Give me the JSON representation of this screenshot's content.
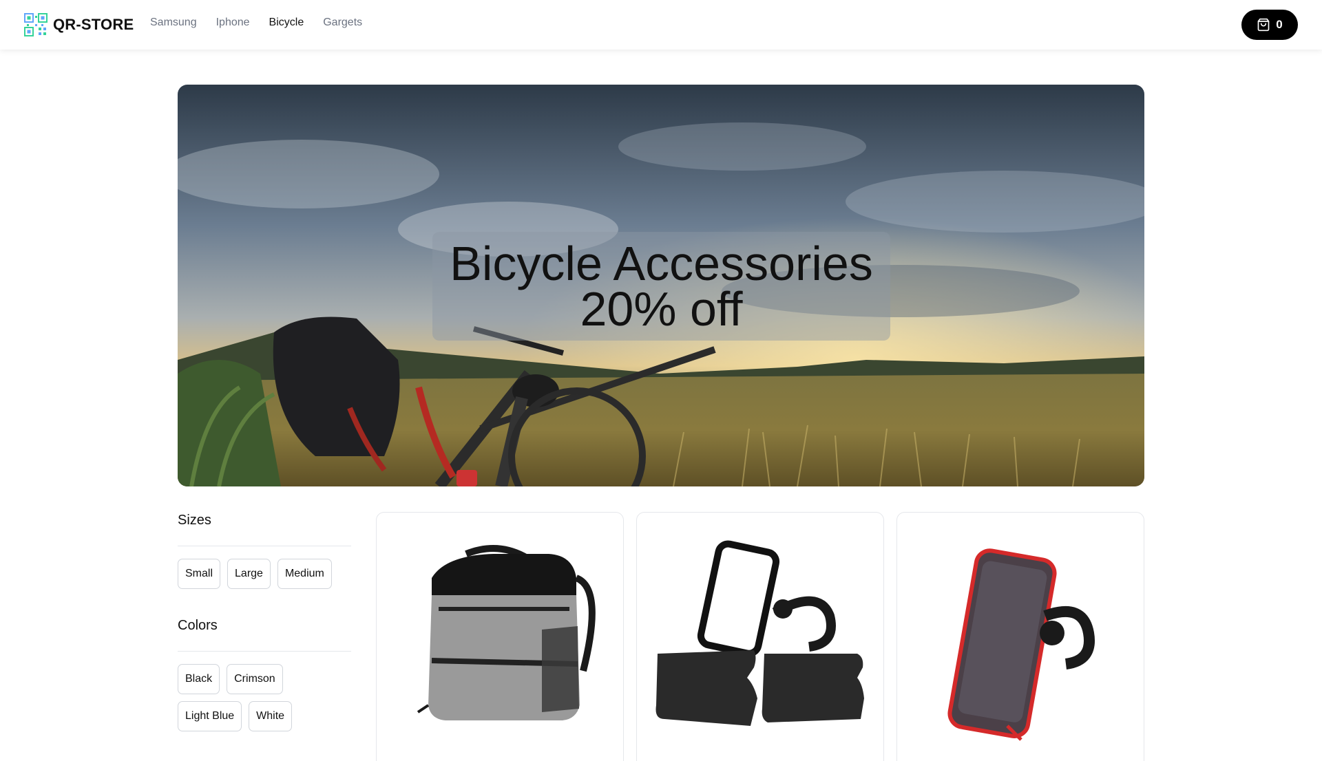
{
  "header": {
    "brand": "QR-STORE",
    "nav": [
      {
        "label": "Samsung",
        "active": false
      },
      {
        "label": "Iphone",
        "active": false
      },
      {
        "label": "Bicycle",
        "active": true
      },
      {
        "label": "Gargets",
        "active": false
      }
    ],
    "cart_count": "0"
  },
  "hero": {
    "title": "Bicycle Accessories",
    "subtitle": "20% off"
  },
  "filters": {
    "sizes": {
      "heading": "Sizes",
      "options": [
        "Small",
        "Large",
        "Medium"
      ]
    },
    "colors": {
      "heading": "Colors",
      "options": [
        "Black",
        "Crimson",
        "Light Blue",
        "White"
      ]
    }
  },
  "colors": {
    "accent": "#000000",
    "nav_inactive": "#6b7280",
    "border": "#e5e7eb"
  },
  "icons": {
    "logo": "qr-code-icon",
    "cart": "shopping-bag-icon"
  }
}
